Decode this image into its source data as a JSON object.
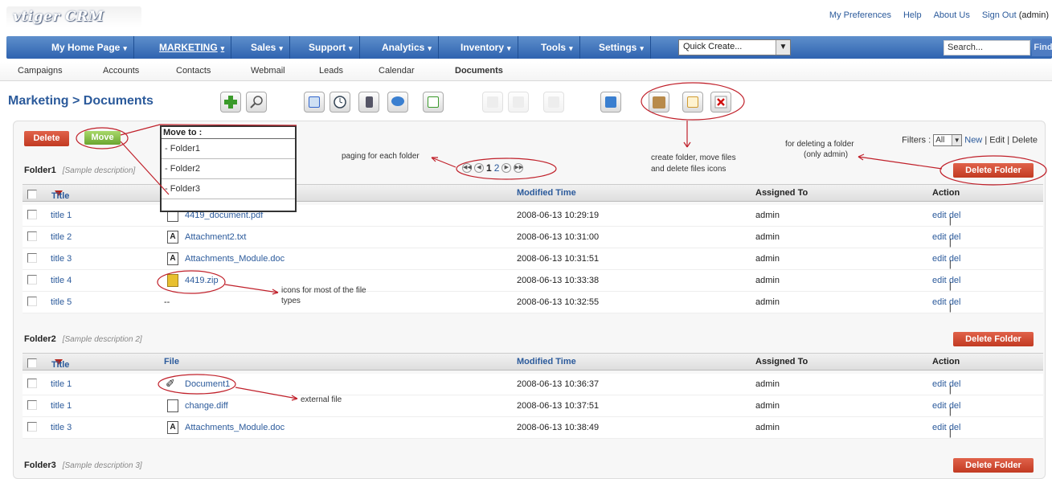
{
  "app": {
    "logo": "vtiger CRM"
  },
  "toplinks": {
    "prefs": "My Preferences",
    "help": "Help",
    "about": "About Us",
    "signout": "Sign Out",
    "user": "(admin)"
  },
  "mainnav": {
    "items": [
      "My Home Page",
      "MARKETING",
      "Sales",
      "Support",
      "Analytics",
      "Inventory",
      "Tools",
      "Settings"
    ],
    "quick_create": "Quick Create...",
    "search_placeholder": "Search...",
    "find": "Find"
  },
  "subnav": [
    "Campaigns",
    "Accounts",
    "Contacts",
    "Webmail",
    "Leads",
    "Calendar",
    "Documents"
  ],
  "page_title": "Marketing > Documents",
  "buttons": {
    "delete": "Delete",
    "move": "Move",
    "delete_folder": "Delete Folder"
  },
  "move_to": {
    "header": "Move to :",
    "options": [
      "- Folder1",
      "- Folder2",
      "- Folder3"
    ]
  },
  "filters": {
    "label": "Filters :",
    "value": "All",
    "new": "New",
    "edit": "Edit",
    "delete": "Delete"
  },
  "pager": {
    "pages": [
      "1",
      "2"
    ]
  },
  "columns": {
    "title": "Title",
    "file": "File",
    "modified": "Modified Time",
    "assigned": "Assigned To",
    "action": "Action"
  },
  "folders": [
    {
      "name": "Folder1",
      "desc": "[Sample description]",
      "rows": [
        {
          "title": "title 1",
          "file": "4419_document.pdf",
          "icon": "page",
          "modified": "2008-06-13 10:29:19",
          "assigned": "admin"
        },
        {
          "title": "title 2",
          "file": "Attachment2.txt",
          "icon": "text",
          "modified": "2008-06-13 10:31:00",
          "assigned": "admin"
        },
        {
          "title": "title 3",
          "file": "Attachments_Module.doc",
          "icon": "text",
          "modified": "2008-06-13 10:31:51",
          "assigned": "admin"
        },
        {
          "title": "title 4",
          "file": "4419.zip",
          "icon": "zip",
          "modified": "2008-06-13 10:33:38",
          "assigned": "admin"
        },
        {
          "title": "title 5",
          "file": "--",
          "icon": "",
          "modified": "2008-06-13 10:32:55",
          "assigned": "admin"
        }
      ]
    },
    {
      "name": "Folder2",
      "desc": "[Sample description 2]",
      "rows": [
        {
          "title": "title 1",
          "file": "Document1",
          "icon": "link",
          "modified": "2008-06-13 10:36:37",
          "assigned": "admin"
        },
        {
          "title": "title 1",
          "file": "change.diff",
          "icon": "page",
          "modified": "2008-06-13 10:37:51",
          "assigned": "admin"
        },
        {
          "title": "title 3",
          "file": "Attachments_Module.doc",
          "icon": "text",
          "modified": "2008-06-13 10:38:49",
          "assigned": "admin"
        }
      ]
    },
    {
      "name": "Folder3",
      "desc": "[Sample description 3]",
      "rows": []
    }
  ],
  "row_actions": {
    "edit": "edit",
    "sep": "|",
    "del": "del"
  },
  "annotations": {
    "paging": "paging for each folder",
    "icons1": "create folder, move files",
    "icons2": "and delete files icons",
    "delfolder1": "for deleting a folder",
    "delfolder2": "(only admin)",
    "types1": "icons for most of the file",
    "types2": "types",
    "external": "external file"
  },
  "colors": {
    "nav": "#2f63b0",
    "link": "#2b5a9b",
    "delete": "#c23a22",
    "move": "#6ba52f",
    "annotation": "#c0202a"
  }
}
